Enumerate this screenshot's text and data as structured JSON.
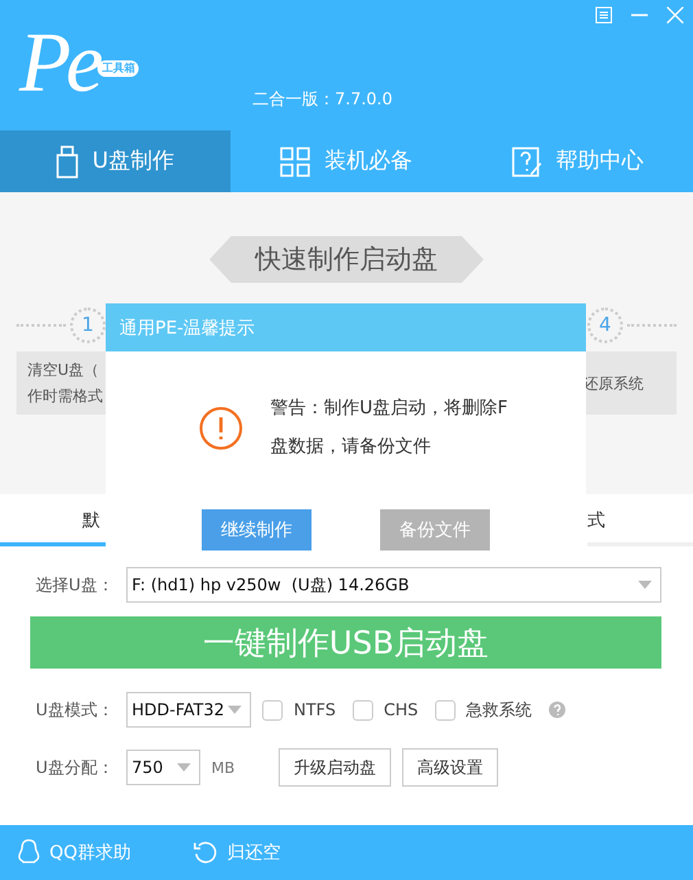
{
  "logo": {
    "text": "Pe",
    "badge": "工具箱"
  },
  "version": "二合一版：7.7.0.0",
  "nav_tabs": [
    {
      "label": "U盘制作",
      "selected": true
    },
    {
      "label": "装机必备",
      "selected": false
    },
    {
      "label": "帮助中心",
      "selected": false
    }
  ],
  "banner": "快速制作启动盘",
  "steps": [
    {
      "number": "1"
    },
    {
      "number": "4"
    }
  ],
  "step_cards": [
    {
      "lines": [
        "清空U盘（",
        "作时需格式"
      ]
    },
    {
      "lines": [
        "还原系统"
      ]
    }
  ],
  "dialog": {
    "title": "通用PE-温馨提示",
    "message_lines": [
      "警告：制作U盘启动，将删除F",
      "盘数据，请备份文件"
    ],
    "buttons": [
      {
        "label": "继续制作",
        "disabled": false
      },
      {
        "label": "备份文件",
        "disabled": true
      }
    ]
  },
  "mode_tabs": [
    {
      "label": "默",
      "selected": true
    },
    {
      "label": "式",
      "selected": false
    }
  ],
  "drive": {
    "label": "选择U盘：",
    "value": "F: (hd1) hp v250w  (U盘) 14.26GB"
  },
  "make_button": "一键制作USB启动盘",
  "mode": {
    "label": "U盘模式：",
    "value": "HDD-FAT32"
  },
  "options": [
    {
      "label": "NTFS",
      "checked": false
    },
    {
      "label": "CHS",
      "checked": false
    },
    {
      "label": "急救系统",
      "checked": false
    }
  ],
  "partition": {
    "label": "U盘分配：",
    "value": "750",
    "unit": "MB"
  },
  "actions": [
    "升级启动盘",
    "高级设置"
  ],
  "status_bar": [
    {
      "label": "QQ群求助"
    },
    {
      "label": "归还空"
    }
  ]
}
